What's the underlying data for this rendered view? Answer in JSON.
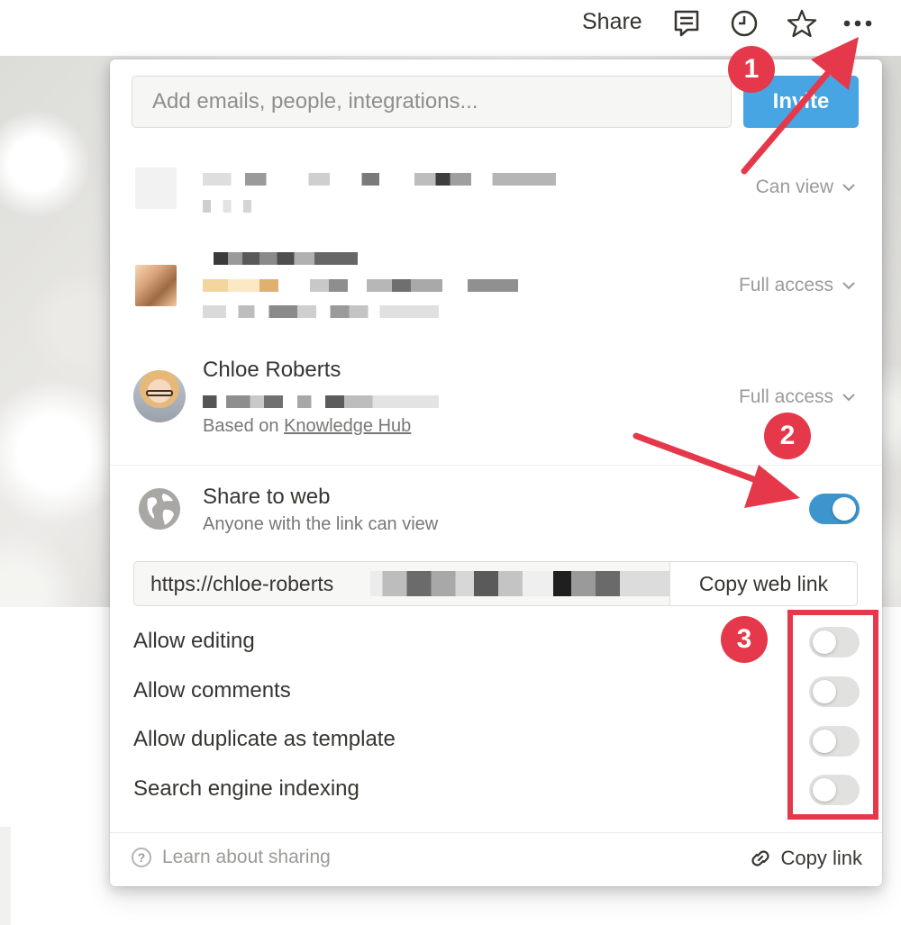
{
  "topbar": {
    "share_label": "Share",
    "icons": [
      "comment-icon",
      "clock-icon",
      "star-icon",
      "more-icon"
    ]
  },
  "invite": {
    "placeholder": "Add emails, people, integrations...",
    "button_label": "Invite"
  },
  "members": [
    {
      "permission": "Can view"
    },
    {
      "permission": "Full access"
    },
    {
      "name": "Chloe Roberts",
      "based_on_prefix": "Based on",
      "based_on_link": "Knowledge Hub",
      "permission": "Full access"
    }
  ],
  "share_to_web": {
    "title": "Share to web",
    "subtitle": "Anyone with the link can view",
    "enabled": true,
    "url_prefix": "https://chloe-roberts",
    "copy_web_link_label": "Copy web link"
  },
  "options": [
    {
      "label": "Allow editing",
      "enabled": false
    },
    {
      "label": "Allow comments",
      "enabled": false
    },
    {
      "label": "Allow duplicate as template",
      "enabled": false
    },
    {
      "label": "Search engine indexing",
      "enabled": false
    }
  ],
  "footer": {
    "learn_label": "Learn about sharing",
    "copy_link_label": "Copy link"
  },
  "annotations": {
    "badge1": "1",
    "badge2": "2",
    "badge3": "3",
    "color": "#e5394b"
  },
  "colors": {
    "toggle_on": "#3d95ce",
    "invite_button": "#46a5e2",
    "text_primary": "#37352f",
    "text_secondary": "#787774"
  }
}
